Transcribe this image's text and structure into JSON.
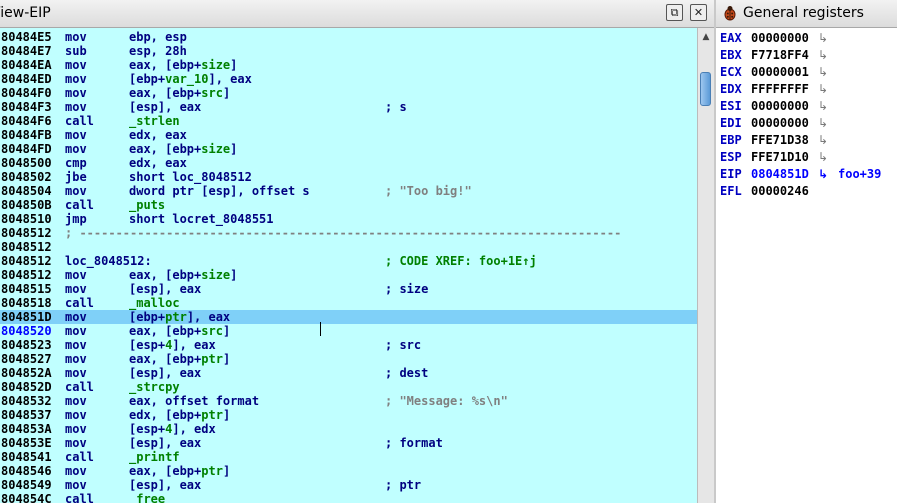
{
  "left_pane": {
    "title": "View-EIP",
    "float_icon": "float-window-icon",
    "close_icon": "close-icon",
    "float_glyph": "⧉",
    "close_glyph": "✕"
  },
  "right_pane": {
    "title": "General registers",
    "icon": "bug-icon"
  },
  "colors": {
    "listing_bg": "#c0ffff",
    "highlight": "#7fd0f8",
    "code": "#000080",
    "names": "#008000",
    "string_comment": "#808080",
    "eip": "#0000ff"
  },
  "scrollbar": {
    "up_glyph": "▲"
  },
  "listing": [
    {
      "addr": "80484E5",
      "mn": "mov",
      "ops": [
        [
          "ebp, esp",
          ""
        ]
      ],
      "cm": ""
    },
    {
      "addr": "80484E7",
      "mn": "sub",
      "ops": [
        [
          "esp, 28h",
          ""
        ]
      ],
      "cm": ""
    },
    {
      "addr": "80484EA",
      "mn": "mov",
      "ops": [
        [
          "eax, [ebp+",
          ""
        ],
        [
          "size",
          "n"
        ],
        [
          "]",
          ""
        ]
      ],
      "cm": ""
    },
    {
      "addr": "80484ED",
      "mn": "mov",
      "ops": [
        [
          "[ebp+",
          ""
        ],
        [
          "var_10",
          "n"
        ],
        [
          "], eax",
          ""
        ]
      ],
      "cm": ""
    },
    {
      "addr": "80484F0",
      "mn": "mov",
      "ops": [
        [
          "eax, [ebp+",
          ""
        ],
        [
          "src",
          "n"
        ],
        [
          "]",
          ""
        ]
      ],
      "cm": ""
    },
    {
      "addr": "80484F3",
      "mn": "mov",
      "ops": [
        [
          "[esp], eax",
          ""
        ]
      ],
      "cm": "; s"
    },
    {
      "addr": "80484F6",
      "mn": "call",
      "ops": [
        [
          "_strlen",
          "n"
        ]
      ],
      "cm": ""
    },
    {
      "addr": "80484FB",
      "mn": "mov",
      "ops": [
        [
          "edx, eax",
          ""
        ]
      ],
      "cm": ""
    },
    {
      "addr": "80484FD",
      "mn": "mov",
      "ops": [
        [
          "eax, [ebp+",
          ""
        ],
        [
          "size",
          "n"
        ],
        [
          "]",
          ""
        ]
      ],
      "cm": ""
    },
    {
      "addr": "8048500",
      "mn": "cmp",
      "ops": [
        [
          "edx, eax",
          ""
        ]
      ],
      "cm": ""
    },
    {
      "addr": "8048502",
      "mn": "jbe",
      "ops": [
        [
          "short loc_8048512",
          ""
        ]
      ],
      "cm": ""
    },
    {
      "addr": "8048504",
      "mn": "mov",
      "ops": [
        [
          "dword ptr [esp], offset s",
          ""
        ]
      ],
      "cm": "; \"Too big!\"",
      "cmstr": true
    },
    {
      "addr": "804850B",
      "mn": "call",
      "ops": [
        [
          "_puts",
          "n"
        ]
      ],
      "cm": ""
    },
    {
      "addr": "8048510",
      "mn": "jmp",
      "ops": [
        [
          "short locret_8048551",
          ""
        ]
      ],
      "cm": ""
    },
    {
      "addr": "8048512",
      "sep": "; ---------------------------------------------------------------------------"
    },
    {
      "addr": "8048512",
      "mn": "",
      "ops": [],
      "cm": ""
    },
    {
      "addr": "8048512",
      "label": "loc_8048512:",
      "cm": "; CODE XREF: foo+1E↑j",
      "cmxref": true
    },
    {
      "addr": "8048512",
      "mn": "mov",
      "ops": [
        [
          "eax, [ebp+",
          ""
        ],
        [
          "size",
          "n"
        ],
        [
          "]",
          ""
        ]
      ],
      "cm": ""
    },
    {
      "addr": "8048515",
      "mn": "mov",
      "ops": [
        [
          "[esp], eax",
          ""
        ]
      ],
      "cm": "; size"
    },
    {
      "addr": "8048518",
      "mn": "call",
      "ops": [
        [
          "_malloc",
          "n"
        ]
      ],
      "cm": ""
    },
    {
      "addr": "804851D",
      "mn": "mov",
      "ops": [
        [
          "[ebp+",
          ""
        ],
        [
          "ptr",
          "n"
        ],
        [
          "], eax",
          ""
        ]
      ],
      "cm": "",
      "hl": true
    },
    {
      "addr": "8048520",
      "mn": "mov",
      "ops": [
        [
          "eax, [ebp+",
          ""
        ],
        [
          "src",
          "n"
        ],
        [
          "]",
          ""
        ]
      ],
      "cm": "",
      "eipaddr": true
    },
    {
      "addr": "8048523",
      "mn": "mov",
      "ops": [
        [
          "[esp+",
          ""
        ],
        [
          "4",
          "n"
        ],
        [
          "], eax",
          ""
        ]
      ],
      "cm": "; src"
    },
    {
      "addr": "8048527",
      "mn": "mov",
      "ops": [
        [
          "eax, [ebp+",
          ""
        ],
        [
          "ptr",
          "n"
        ],
        [
          "]",
          ""
        ]
      ],
      "cm": ""
    },
    {
      "addr": "804852A",
      "mn": "mov",
      "ops": [
        [
          "[esp], eax",
          ""
        ]
      ],
      "cm": "; dest"
    },
    {
      "addr": "804852D",
      "mn": "call",
      "ops": [
        [
          "_strcpy",
          "n"
        ]
      ],
      "cm": ""
    },
    {
      "addr": "8048532",
      "mn": "mov",
      "ops": [
        [
          "eax, offset format",
          ""
        ]
      ],
      "cm": "; \"Message: %s\\n\"",
      "cmstr": true
    },
    {
      "addr": "8048537",
      "mn": "mov",
      "ops": [
        [
          "edx, [ebp+",
          ""
        ],
        [
          "ptr",
          "n"
        ],
        [
          "]",
          ""
        ]
      ],
      "cm": ""
    },
    {
      "addr": "804853A",
      "mn": "mov",
      "ops": [
        [
          "[esp+",
          ""
        ],
        [
          "4",
          "n"
        ],
        [
          "], edx",
          ""
        ]
      ],
      "cm": ""
    },
    {
      "addr": "804853E",
      "mn": "mov",
      "ops": [
        [
          "[esp], eax",
          ""
        ]
      ],
      "cm": "; format"
    },
    {
      "addr": "8048541",
      "mn": "call",
      "ops": [
        [
          "_printf",
          "n"
        ]
      ],
      "cm": ""
    },
    {
      "addr": "8048546",
      "mn": "mov",
      "ops": [
        [
          "eax, [ebp+",
          ""
        ],
        [
          "ptr",
          "n"
        ],
        [
          "]",
          ""
        ]
      ],
      "cm": ""
    },
    {
      "addr": "8048549",
      "mn": "mov",
      "ops": [
        [
          "[esp], eax",
          ""
        ]
      ],
      "cm": "; ptr"
    },
    {
      "addr": "804854C",
      "mn": "call",
      "ops": [
        [
          "_free",
          "n"
        ]
      ],
      "cm": ""
    }
  ],
  "registers": [
    {
      "name": "EAX",
      "value": "00000000",
      "arrow": "↳"
    },
    {
      "name": "EBX",
      "value": "F7718FF4",
      "arrow": "↳"
    },
    {
      "name": "ECX",
      "value": "00000001",
      "arrow": "↳"
    },
    {
      "name": "EDX",
      "value": "FFFFFFFF",
      "arrow": "↳"
    },
    {
      "name": "ESI",
      "value": "00000000",
      "arrow": "↳"
    },
    {
      "name": "EDI",
      "value": "00000000",
      "arrow": "↳"
    },
    {
      "name": "EBP",
      "value": "FFE71D38",
      "arrow": "↳"
    },
    {
      "name": "ESP",
      "value": "FFE71D10",
      "arrow": "↳"
    },
    {
      "name": "EIP",
      "value": "0804851D",
      "arrow": "↳",
      "label": "foo+39",
      "eip": true
    },
    {
      "name": "EFL",
      "value": "00000246",
      "arrow": ""
    }
  ]
}
